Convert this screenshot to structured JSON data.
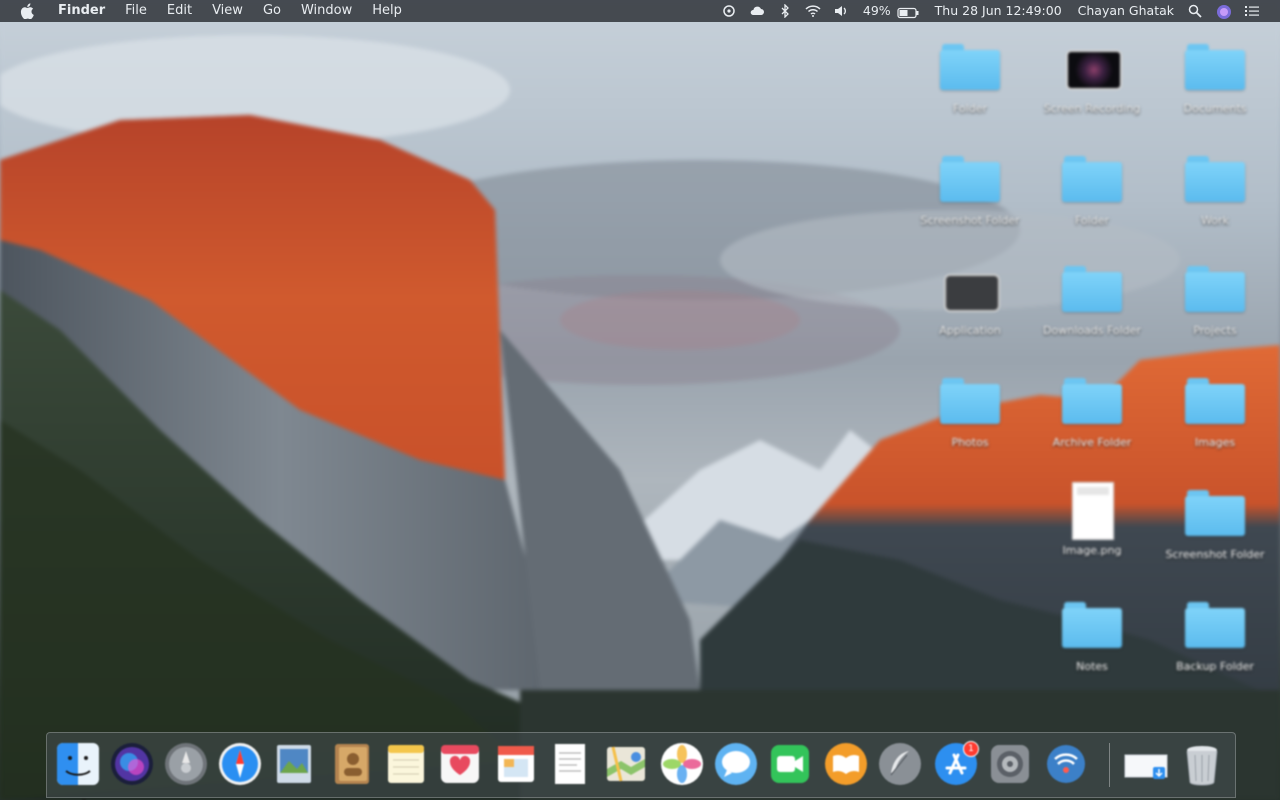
{
  "menubar": {
    "app_name": "Finder",
    "menus": [
      "File",
      "Edit",
      "View",
      "Go",
      "Window",
      "Help"
    ],
    "battery_percent": "49%",
    "clock": "Thu 28 Jun  12:49:00",
    "user": "Chayan Ghatak"
  },
  "desktop": {
    "items": [
      {
        "label": "Folder",
        "kind": "folder"
      },
      {
        "label": "Screen Recording",
        "kind": "video"
      },
      {
        "label": "Documents",
        "kind": "folder"
      },
      {
        "label": "Screenshot Folder",
        "kind": "folder"
      },
      {
        "label": "Folder",
        "kind": "folder"
      },
      {
        "label": "Work",
        "kind": "folder"
      },
      {
        "label": "Application",
        "kind": "app"
      },
      {
        "label": "Downloads Folder",
        "kind": "folder"
      },
      {
        "label": "Projects",
        "kind": "folder"
      },
      {
        "label": "Photos",
        "kind": "folder"
      },
      {
        "label": "Archive Folder",
        "kind": "folder"
      },
      {
        "label": "Images",
        "kind": "folder"
      },
      {
        "label": "Image.png",
        "kind": "document"
      },
      {
        "label": "Screenshot Folder",
        "kind": "folder"
      },
      {
        "label": "Notes",
        "kind": "folder"
      },
      {
        "label": "Backup Folder",
        "kind": "folder"
      }
    ]
  },
  "dock": {
    "apps": [
      {
        "name": "Finder",
        "icon": "finder-icon",
        "running": true
      },
      {
        "name": "Siri",
        "icon": "siri-icon"
      },
      {
        "name": "Launchpad",
        "icon": "launchpad-icon"
      },
      {
        "name": "Safari",
        "icon": "safari-icon"
      },
      {
        "name": "Preview",
        "icon": "preview-icon"
      },
      {
        "name": "Contacts",
        "icon": "contacts-icon"
      },
      {
        "name": "Notes",
        "icon": "notes-icon"
      },
      {
        "name": "Reminders",
        "icon": "reminders-icon"
      },
      {
        "name": "Calendar",
        "icon": "calendar-icon"
      },
      {
        "name": "TextEdit",
        "icon": "textedit-icon"
      },
      {
        "name": "Maps",
        "icon": "maps-icon"
      },
      {
        "name": "Photos",
        "icon": "photos-icon"
      },
      {
        "name": "Messages",
        "icon": "messages-icon"
      },
      {
        "name": "FaceTime",
        "icon": "facetime-icon"
      },
      {
        "name": "iBooks",
        "icon": "ibooks-icon"
      },
      {
        "name": "Feather",
        "icon": "feather-icon"
      },
      {
        "name": "App Store",
        "icon": "app-store-icon",
        "badge": "1"
      },
      {
        "name": "System Preferences",
        "icon": "system-preferences-icon"
      },
      {
        "name": "Network Utility",
        "icon": "network-icon"
      }
    ],
    "extras": [
      {
        "name": "Downloads",
        "icon": "downloads-stack-icon"
      },
      {
        "name": "Trash",
        "icon": "trash-icon"
      }
    ]
  },
  "colors": {
    "folder_blue": "#6cc6f2",
    "menubar_bg": "#2c3036",
    "sunset_orange": "#d2522a"
  }
}
